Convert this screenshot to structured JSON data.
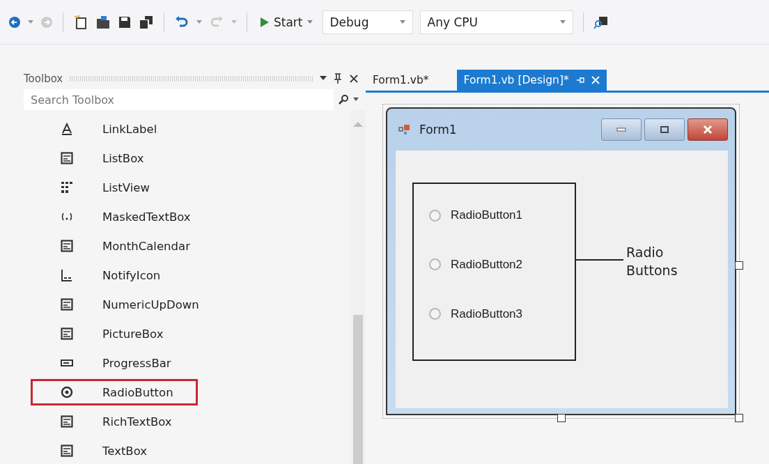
{
  "toolbar": {
    "start": "Start",
    "configuration": "Debug",
    "platform": "Any CPU"
  },
  "toolbox": {
    "title": "Toolbox",
    "search": {
      "placeholder": "Search Toolbox"
    },
    "items": [
      {
        "label": "LinkLabel",
        "selected": false
      },
      {
        "label": "ListBox",
        "selected": false
      },
      {
        "label": "ListView",
        "selected": false
      },
      {
        "label": "MaskedTextBox",
        "selected": false
      },
      {
        "label": "MonthCalendar",
        "selected": false
      },
      {
        "label": "NotifyIcon",
        "selected": false
      },
      {
        "label": "NumericUpDown",
        "selected": false
      },
      {
        "label": "PictureBox",
        "selected": false
      },
      {
        "label": "ProgressBar",
        "selected": false
      },
      {
        "label": "RadioButton",
        "selected": true
      },
      {
        "label": "RichTextBox",
        "selected": false
      },
      {
        "label": "TextBox",
        "selected": false
      }
    ]
  },
  "tabs": [
    {
      "label": "Form1.vb*",
      "selected": false
    },
    {
      "label": "Form1.vb [Design]*",
      "selected": true
    }
  ],
  "form": {
    "title": "Form1",
    "radio_buttons": [
      {
        "label": "RadioButton1",
        "checked": false
      },
      {
        "label": "RadioButton2",
        "checked": false
      },
      {
        "label": "RadioButton3",
        "checked": false
      }
    ],
    "annotation": "Radio Buttons"
  }
}
